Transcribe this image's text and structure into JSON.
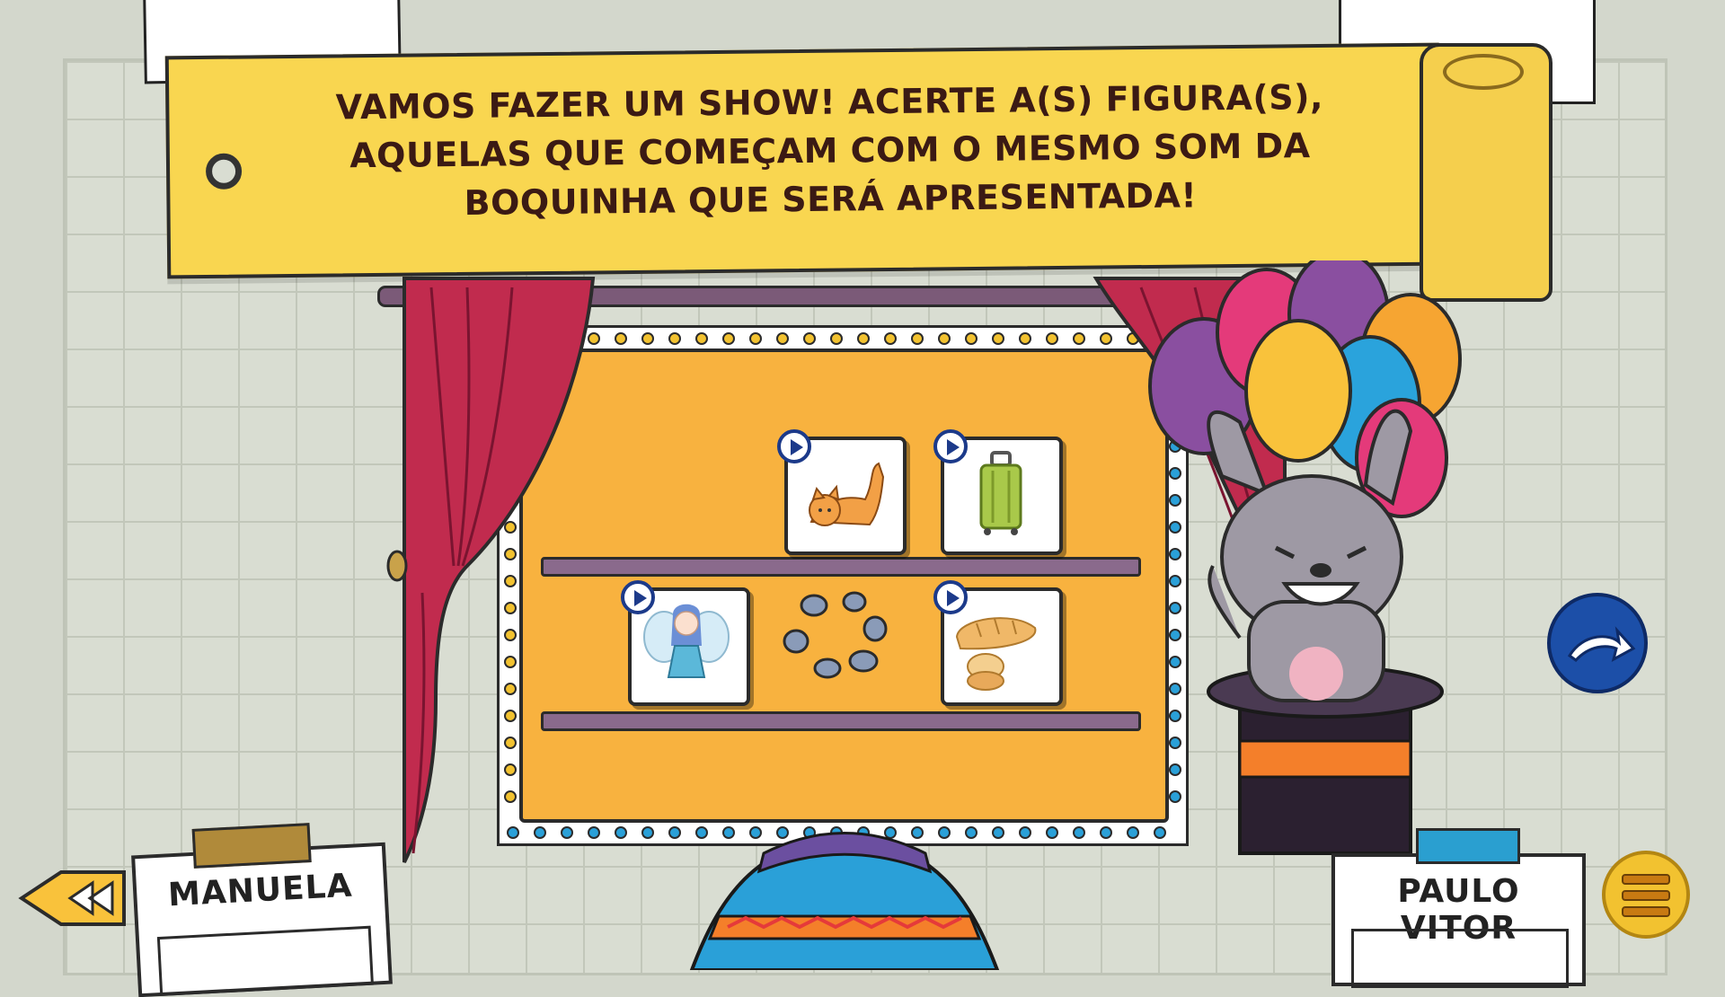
{
  "banner": {
    "lines": [
      "VAMOS FAZER UM SHOW! ACERTE A(S) FIGURA(S),",
      "AQUELAS QUE COMEÇAM COM O MESMO SOM DA",
      "BOQUINHA QUE SERÁ APRESENTADA!"
    ]
  },
  "players": {
    "left": "MANUELA",
    "right": "PAULO VITOR"
  },
  "cards": [
    {
      "name": "cat",
      "icon": "cat-icon"
    },
    {
      "name": "suitcase",
      "icon": "suitcase-icon"
    },
    {
      "name": "fairy",
      "icon": "fairy-icon"
    },
    {
      "name": "bread",
      "icon": "bread-icon"
    }
  ],
  "icons": {
    "back": "rewind-icon",
    "next": "arrow-right-icon",
    "menu": "menu-icon"
  },
  "colors": {
    "banner": "#f9d650",
    "stage": "#f8b23f",
    "curtain": "#c12b4e",
    "next_button": "#1c4fa8",
    "menu_button": "#f2c230"
  }
}
